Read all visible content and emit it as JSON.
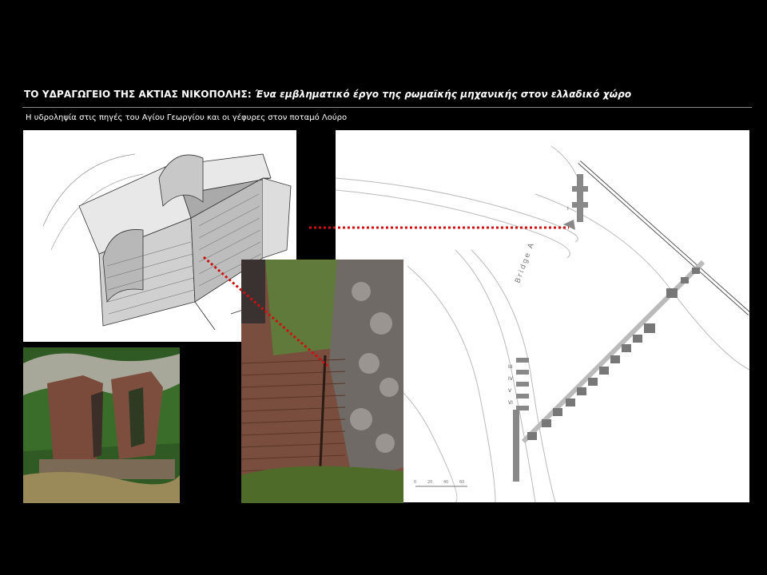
{
  "header": {
    "title_main": "ΤΟ ΥΔΡΑΓΩΓΕΙΟ ΤΗΣ ΑΚΤΙΑΣ ΝΙΚΟΠΟΛΗΣ:",
    "title_sub": "Ένα εμβληματικό έργο της ρωμαϊκής μηχανικής στον ελλαδικό χώρο",
    "subtitle": "Η υδροληψία στις πηγές του Αγίου Γεωργίου και οι γέφυρες στον ποταμό Λούρο"
  },
  "map": {
    "bridge_label": "Bridge A",
    "pier_labels": [
      "III",
      "IV",
      "V",
      "VI"
    ],
    "marker_label": "I",
    "scale_labels": [
      "0",
      "20",
      "40",
      "60"
    ]
  },
  "colors": {
    "background": "#000000",
    "connector": "#cc1111",
    "panel": "#ffffff"
  },
  "icons": {
    "connector": "red-dotted-line"
  }
}
